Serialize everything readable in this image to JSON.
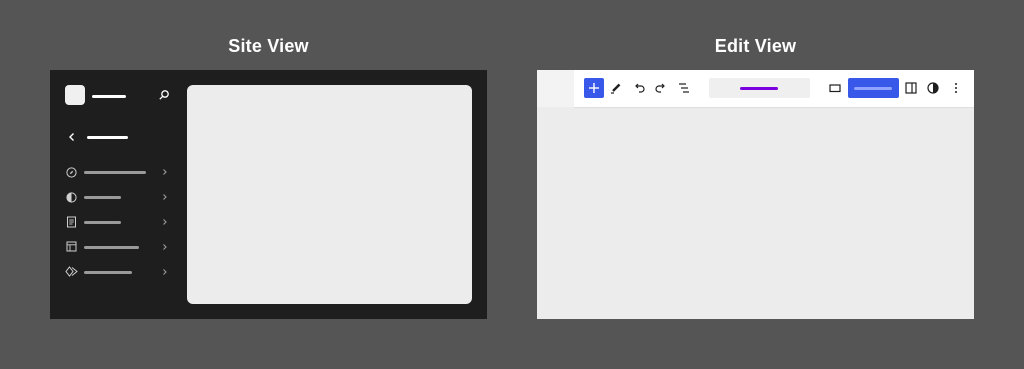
{
  "titles": {
    "site_view": "Site View",
    "edit_view": "Edit View"
  },
  "site_view": {
    "header": {
      "logo": "site-logo-placeholder",
      "search_icon": "search-icon"
    },
    "back_icon": "chevron-left-icon",
    "nav_items": [
      {
        "icon": "compass-icon",
        "chevron": "chevron-right-icon"
      },
      {
        "icon": "half-circle-icon",
        "chevron": "chevron-right-icon"
      },
      {
        "icon": "page-icon",
        "chevron": "chevron-right-icon"
      },
      {
        "icon": "layout-icon",
        "chevron": "chevron-right-icon"
      },
      {
        "icon": "pattern-diamond-icon",
        "chevron": "chevron-right-icon"
      }
    ],
    "colors": {
      "frame": "#1e1e1e",
      "canvas": "#ececec",
      "text_bar": "#9a9a9a"
    }
  },
  "edit_view": {
    "toolbar": {
      "buttons": [
        "plus-icon",
        "pencil-icon",
        "undo-icon",
        "redo-icon",
        "list-view-icon",
        "desktop-icon",
        "sidebar-icon",
        "half-circle-icon",
        "more-vertical-icon"
      ]
    },
    "colors": {
      "primary": "#3858e9",
      "document_accent": "#7a00df",
      "canvas": "#ececec"
    }
  }
}
